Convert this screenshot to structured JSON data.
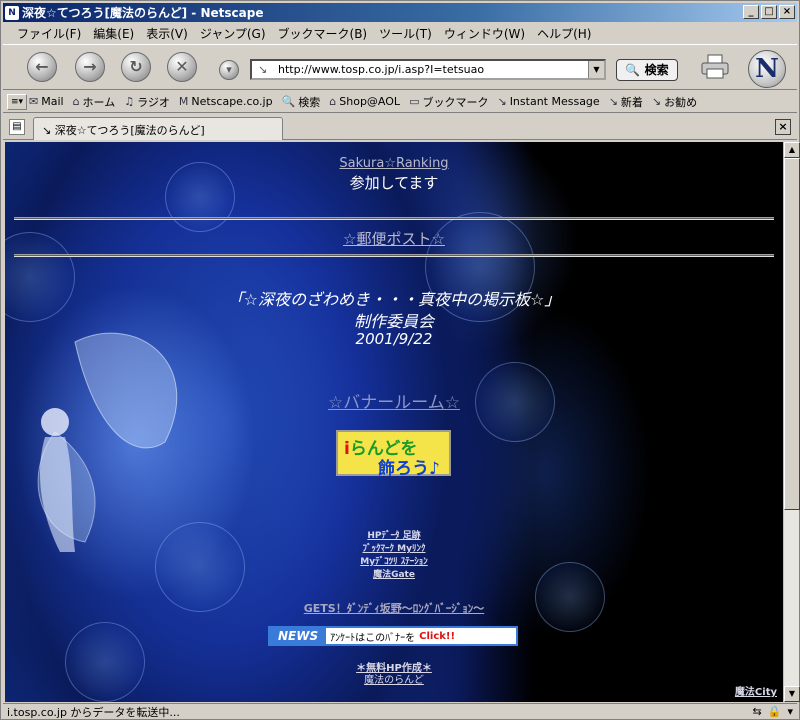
{
  "window": {
    "title": "深夜☆てつろう[魔法のらんど] - Netscape",
    "app_icon": "N"
  },
  "menu": [
    "ファイル(F)",
    "編集(E)",
    "表示(V)",
    "ジャンプ(G)",
    "ブックマーク(B)",
    "ツール(T)",
    "ウィンドウ(W)",
    "ヘルプ(H)"
  ],
  "navigation": {
    "url": "http://www.tosp.co.jp/i.asp?I=tetsuao",
    "search_label": "検索"
  },
  "personal_toolbar": [
    {
      "icon": "mail-icon",
      "glyph": "✉",
      "label": "Mail"
    },
    {
      "icon": "home-icon",
      "glyph": "⌂",
      "label": "ホーム"
    },
    {
      "icon": "radio-icon",
      "glyph": "♫",
      "label": "ラジオ"
    },
    {
      "icon": "my-icon",
      "glyph": "M",
      "label": "Netscape.co.jp"
    },
    {
      "icon": "search-icon",
      "glyph": "🔍",
      "label": "検索"
    },
    {
      "icon": "shop-icon",
      "glyph": "⌂",
      "label": "Shop@AOL"
    },
    {
      "icon": "folder-icon",
      "glyph": "▭",
      "label": "ブックマーク"
    },
    {
      "icon": "link-icon",
      "glyph": "↘",
      "label": "Instant Message"
    },
    {
      "icon": "link-icon",
      "glyph": "↘",
      "label": "新着"
    },
    {
      "icon": "link-icon",
      "glyph": "↘",
      "label": "お勧め"
    }
  ],
  "tab": {
    "label": "深夜☆てつろう[魔法のらんど]"
  },
  "content": {
    "ranking_link": "Sakura☆Ranking",
    "ranking_sub": "参加してます",
    "post_link": "☆郵便ポスト☆",
    "bbs_title": "「☆深夜のざわめき・・・真夜中の掲示板☆」",
    "committee": "制作委員会",
    "date": "2001/9/22",
    "banner_room_link": "☆バナールーム☆",
    "iland_banner": {
      "line1_i": "i",
      "line1_rest": "らんどを",
      "line2": "飾ろう♪"
    },
    "small_links": [
      "HPﾃﾞｰﾀ 足跡",
      "ﾌﾞｯｸﾏｰｸ Myﾘﾝｸ",
      "Myﾃﾞｺﾂﾘ ｽﾃｰｼｮﾝ",
      "魔法Gate"
    ],
    "gets_link": "GETS！ﾀﾞﾝﾃﾞｨ坂野～ﾛﾝｸﾞﾊﾞｰｼﾞｮﾝ～",
    "news": {
      "label": "NEWS",
      "text": "ｱﾝｹｰﾄはこのﾊﾞﾅｰを",
      "click": "Click!!"
    },
    "free_hp_link": "＊無料HP作成＊",
    "maho_link": "魔法のらんど",
    "corner_link": "魔法City"
  },
  "status": {
    "text": "i.tosp.co.jp からデータを転送中..."
  }
}
